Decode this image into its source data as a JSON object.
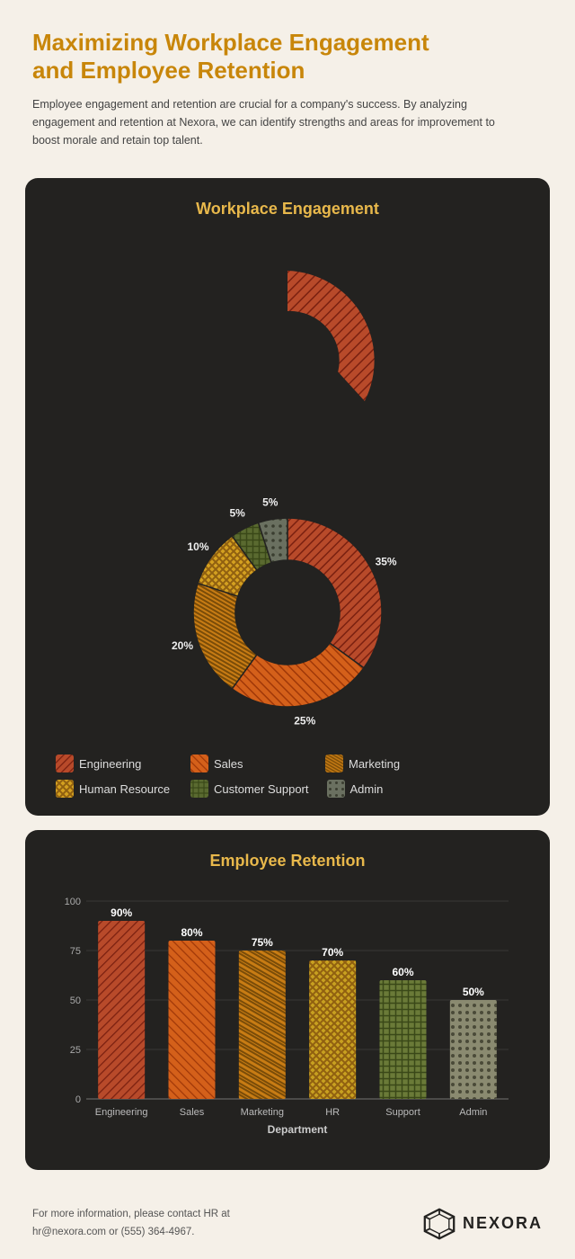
{
  "page": {
    "title_line1": "Maximizing Workplace Engagement",
    "title_line2": "and Employee Retention",
    "subtitle": "Employee engagement and retention are crucial for a company's success. By analyzing engagement and retention at Nexora, we can identify strengths and areas for improvement to boost morale and retain top talent."
  },
  "donut_chart": {
    "title": "Workplace Engagement",
    "segments": [
      {
        "label": "Engineering",
        "value": 35,
        "color": "#b84a2a",
        "pattern": "hatch-eng"
      },
      {
        "label": "Sales",
        "value": 25,
        "color": "#d4601a",
        "pattern": "hatch-sales"
      },
      {
        "label": "Marketing",
        "value": 20,
        "color": "#c87c14",
        "pattern": "hatch-mkt"
      },
      {
        "label": "Human Resource",
        "value": 10,
        "color": "#d4a020",
        "pattern": "hatch-hr"
      },
      {
        "label": "Customer Support",
        "value": 5,
        "color": "#5a6a30",
        "pattern": "hatch-cs"
      },
      {
        "label": "Admin",
        "value": 5,
        "color": "#6a7060",
        "pattern": "hatch-admin"
      }
    ],
    "legend": [
      {
        "label": "Engineering",
        "color": "#b84a2a"
      },
      {
        "label": "Sales",
        "color": "#d4601a"
      },
      {
        "label": "Marketing",
        "color": "#c87c14"
      },
      {
        "label": "Human Resource",
        "color": "#d4a020"
      },
      {
        "label": "Customer Support",
        "color": "#5a6a30"
      },
      {
        "label": "Admin",
        "color": "#6a7060"
      }
    ]
  },
  "bar_chart": {
    "title": "Employee Retention",
    "x_axis_label": "Department",
    "y_labels": [
      "100",
      "75",
      "50",
      "25",
      "0"
    ],
    "bars": [
      {
        "label": "Engineering",
        "value": 90,
        "color": "#b84a2a"
      },
      {
        "label": "Sales",
        "value": 80,
        "color": "#d4601a"
      },
      {
        "label": "Marketing",
        "value": 75,
        "color": "#c87c14"
      },
      {
        "label": "HR",
        "value": 70,
        "color": "#c8a020"
      },
      {
        "label": "Support",
        "value": 60,
        "color": "#6a7a38"
      },
      {
        "label": "Admin",
        "value": 50,
        "color": "#8a8a70"
      }
    ]
  },
  "footer": {
    "contact_text": "For more information, please contact HR at\nhr@nexora.com or (555) 364-4967.",
    "logo_text": "NEXORA"
  }
}
